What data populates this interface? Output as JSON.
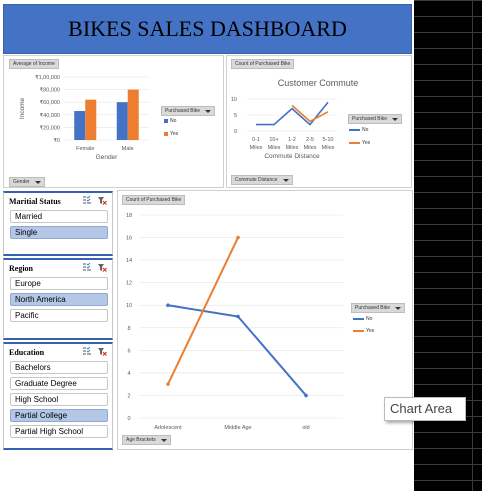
{
  "dashboard": {
    "title": "BIKES SALES DASHBOARD"
  },
  "colors": {
    "header_bg": "#4472c4",
    "series_no": "#4472c4",
    "series_yes": "#ed7d31",
    "slicer_selected": "#b4c7e7"
  },
  "income_chart": {
    "field_button": "Average of Income",
    "filter_button": "Gender",
    "legend_button": "Purchased Bike",
    "ylabel": "Income",
    "xlabel": "Gender",
    "y_ticks": [
      "₹1,00,000",
      "₹80,000",
      "₹60,000",
      "₹40,000",
      "₹20,000",
      "₹0"
    ]
  },
  "commute_chart": {
    "field_button": "Count of Purchased Bike",
    "filter_button": "Commute Distance",
    "legend_button": "Purchased Bike",
    "y_ticks": [
      "10",
      "5",
      "0"
    ]
  },
  "age_chart": {
    "field_button": "Count of Purchased Bike",
    "filter_button": "Age Brackets",
    "legend_button": "Purchased Bike",
    "y_ticks": [
      "18",
      "16",
      "14",
      "12",
      "10",
      "8",
      "6",
      "4",
      "2",
      "0"
    ]
  },
  "chart_data": [
    {
      "type": "bar",
      "title": "",
      "xlabel": "Gender",
      "ylabel": "Income",
      "categories": [
        "Female",
        "Male"
      ],
      "series": [
        {
          "name": "No",
          "values": [
            46000,
            60000
          ]
        },
        {
          "name": "Yes",
          "values": [
            64000,
            80000
          ]
        }
      ],
      "ylim": [
        0,
        100000
      ],
      "grid": true,
      "legend": "right"
    },
    {
      "type": "line",
      "title": "Customer Commute",
      "xlabel": "Commute Distance",
      "ylabel": "",
      "categories": [
        "0-1 Miles",
        "10+ Miles",
        "1-2 Miles",
        "2-5 Miles",
        "5-10 Miles"
      ],
      "series": [
        {
          "name": "No",
          "values": [
            2,
            2,
            7,
            2,
            9
          ]
        },
        {
          "name": "Yes",
          "values": [
            null,
            null,
            8,
            3,
            6
          ]
        }
      ],
      "ylim": [
        0,
        10
      ],
      "grid": true,
      "legend": "right"
    },
    {
      "type": "line",
      "title": "",
      "xlabel": "",
      "ylabel": "",
      "categories": [
        "Adolescent",
        "Middle Age",
        "old"
      ],
      "series": [
        {
          "name": "No",
          "values": [
            10,
            9,
            2
          ]
        },
        {
          "name": "Yes",
          "values": [
            3,
            16,
            null
          ]
        }
      ],
      "ylim": [
        0,
        18
      ],
      "grid": true,
      "legend": "right"
    }
  ],
  "slicers": {
    "marital": {
      "title": "Maritial Status",
      "items": [
        {
          "label": "Married",
          "selected": false
        },
        {
          "label": "Single",
          "selected": true
        }
      ]
    },
    "region": {
      "title": "Region",
      "items": [
        {
          "label": "Europe",
          "selected": false
        },
        {
          "label": "North America",
          "selected": true
        },
        {
          "label": "Pacific",
          "selected": false
        }
      ]
    },
    "education": {
      "title": "Education",
      "items": [
        {
          "label": "Bachelors",
          "selected": false
        },
        {
          "label": "Graduate Degree",
          "selected": false
        },
        {
          "label": "High School",
          "selected": false
        },
        {
          "label": "Partial College",
          "selected": true
        },
        {
          "label": "Partial High School",
          "selected": false
        }
      ]
    }
  },
  "tooltip": {
    "text": "Chart Area"
  }
}
